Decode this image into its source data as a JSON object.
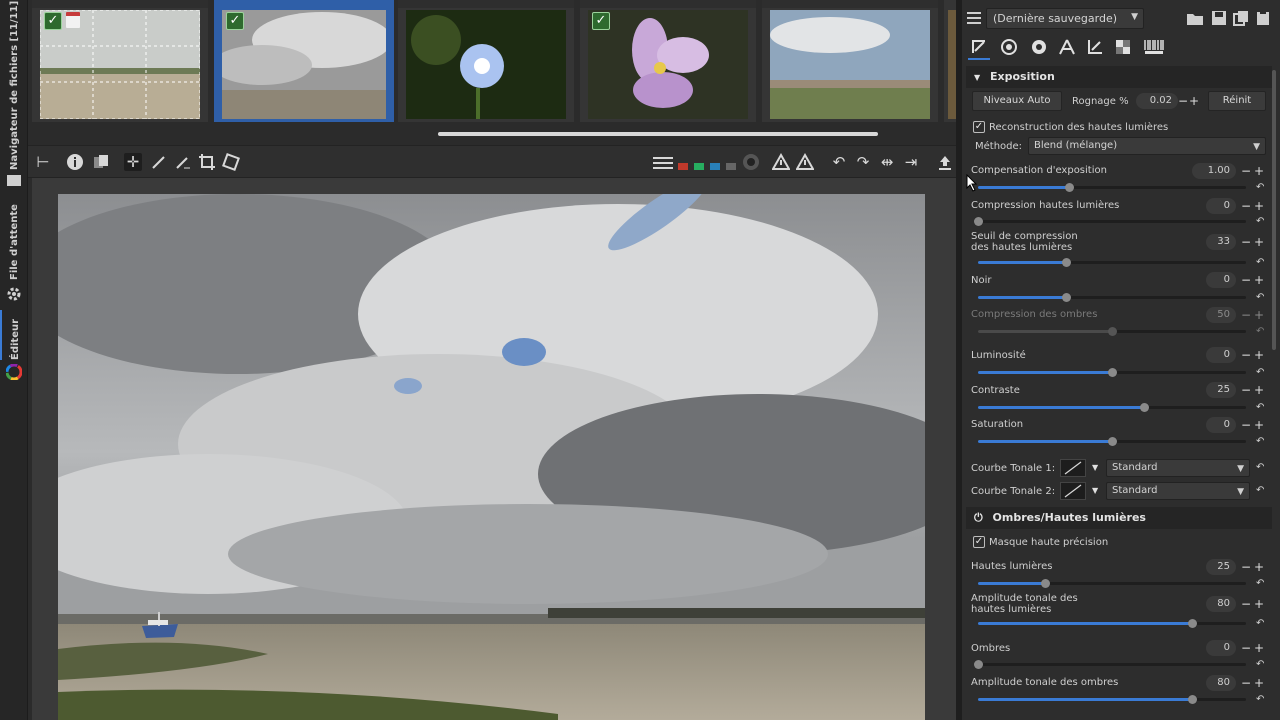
{
  "sidebar": {
    "file_browser_label": "Navigateur de fichiers [11/11]",
    "queue_label": "File d'attente",
    "editor_label": "Éditeur"
  },
  "filmstrip": {
    "thumbs": [
      {
        "checked": true,
        "calendar": true
      },
      {
        "checked": true,
        "calendar": false
      },
      {
        "checked": false,
        "calendar": false
      },
      {
        "checked": true,
        "calendar": false
      },
      {
        "checked": false,
        "calendar": false
      }
    ]
  },
  "panel": {
    "profile": "(Dernière sauvegarde)",
    "exposure": {
      "title": "Exposition",
      "auto_levels": "Niveaux Auto",
      "clip_label": "Rognage %",
      "clip_value": "0.02",
      "reset_button": "Réinit",
      "highlight_reconstruction": "Reconstruction des hautes lumières",
      "method_label": "Méthode:",
      "method_value": "Blend (mélange)",
      "sliders": [
        {
          "label": "Compensation d'exposition",
          "value": "1.00",
          "fraction": 0.34
        },
        {
          "label": "Compression hautes lumières",
          "value": "0",
          "fraction": 0.0
        },
        {
          "label": "Seuil de compression des hautes lumières",
          "value": "33",
          "fraction": 0.33
        },
        {
          "label": "Noir",
          "value": "0",
          "fraction": 0.33
        },
        {
          "label": "Compression des ombres",
          "value": "50",
          "fraction": 0.5
        },
        {
          "label": "Luminosité",
          "value": "0",
          "fraction": 0.5
        },
        {
          "label": "Contraste",
          "value": "25",
          "fraction": 0.62
        },
        {
          "label": "Saturation",
          "value": "0",
          "fraction": 0.5
        }
      ],
      "curve1_label": "Courbe Tonale 1:",
      "curve1_value": "Standard",
      "curve2_label": "Courbe Tonale 2:",
      "curve2_value": "Standard"
    },
    "shadows_highlights": {
      "title": "Ombres/Hautes lumières",
      "high_quality": "Masque haute précision",
      "sliders": [
        {
          "label": "Hautes lumières",
          "value": "25",
          "fraction": 0.25
        },
        {
          "label": "Amplitude tonale des hautes lumières",
          "value": "80",
          "fraction": 0.8
        },
        {
          "label": "Ombres",
          "value": "0",
          "fraction": 0.0
        },
        {
          "label": "Amplitude tonale des ombres",
          "value": "80",
          "fraction": 0.8
        }
      ]
    }
  },
  "colors": {
    "accent": "#3a7bd5",
    "panel_bg": "#2d2d2d",
    "canvas_bg": "#3a3a3a"
  }
}
